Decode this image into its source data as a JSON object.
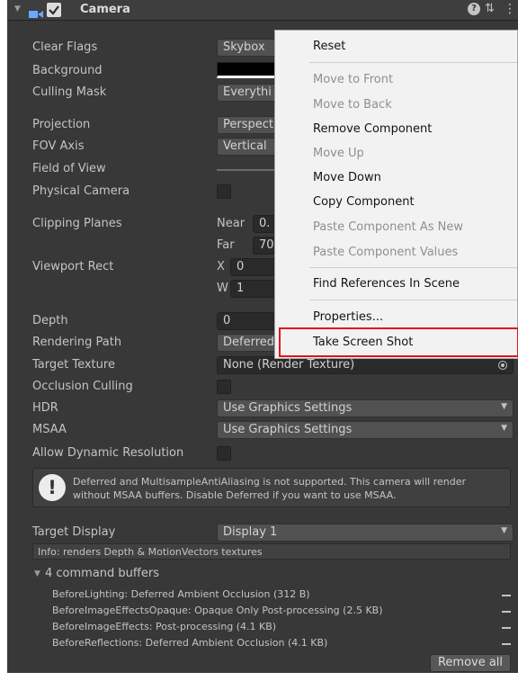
{
  "header": {
    "title": "Camera",
    "help_icon": "help-icon",
    "preset_icon": "preset-icon",
    "more_icon": "kebab-icon"
  },
  "props": {
    "clear_flags": {
      "label": "Clear Flags",
      "value": "Skybox"
    },
    "background": {
      "label": "Background"
    },
    "culling_mask": {
      "label": "Culling Mask",
      "value": "Everythi"
    },
    "projection": {
      "label": "Projection",
      "value": "Perspect"
    },
    "fov_axis": {
      "label": "FOV Axis",
      "value": "Vertical"
    },
    "field_of_view": {
      "label": "Field of View"
    },
    "physical_camera": {
      "label": "Physical Camera"
    },
    "clipping_planes": {
      "label": "Clipping Planes",
      "near_label": "Near",
      "near_value": "0.",
      "far_label": "Far",
      "far_value": "70"
    },
    "viewport_rect": {
      "label": "Viewport Rect",
      "x_label": "X",
      "x_value": "0",
      "w_label": "W",
      "w_value": "1"
    },
    "depth": {
      "label": "Depth",
      "value": "0"
    },
    "rendering_path": {
      "label": "Rendering Path",
      "value": "Deferred"
    },
    "target_texture": {
      "label": "Target Texture",
      "value": "None (Render Texture)"
    },
    "occlusion_culling": {
      "label": "Occlusion Culling"
    },
    "hdr": {
      "label": "HDR",
      "value": "Use Graphics Settings"
    },
    "msaa": {
      "label": "MSAA",
      "value": "Use Graphics Settings"
    },
    "allow_dynamic_resolution": {
      "label": "Allow Dynamic Resolution"
    }
  },
  "warning": {
    "line1": "Deferred and MultisampleAntiAliasing is not supported. This camera will render",
    "line2": "without MSAA buffers. Disable Deferred if you want to use MSAA."
  },
  "target_display": {
    "label": "Target Display",
    "value": "Display 1"
  },
  "info": "Info: renders Depth & MotionVectors textures",
  "command_buffers": {
    "header": "4 command buffers",
    "items": [
      "BeforeLighting: Deferred Ambient Occlusion (312 B)",
      "BeforeImageEffectsOpaque: Opaque Only Post-processing (2.5 KB)",
      "BeforeImageEffects: Post-processing (4.1 KB)",
      "BeforeReflections: Deferred Ambient Occlusion (4.1 KB)"
    ],
    "remove_all": "Remove all"
  },
  "context_menu": {
    "reset": "Reset",
    "move_to_front": "Move to Front",
    "move_to_back": "Move to Back",
    "remove_component": "Remove Component",
    "move_up": "Move Up",
    "move_down": "Move Down",
    "copy_component": "Copy Component",
    "paste_as_new": "Paste Component As New",
    "paste_values": "Paste Component Values",
    "find_references": "Find References In Scene",
    "properties": "Properties...",
    "take_screen_shot": "Take Screen Shot"
  },
  "colors": {
    "panel_bg": "#383838",
    "menu_bg": "#f2f2f2",
    "highlight_border": "#e0141e",
    "camera_icon": "#6aa8ff"
  }
}
